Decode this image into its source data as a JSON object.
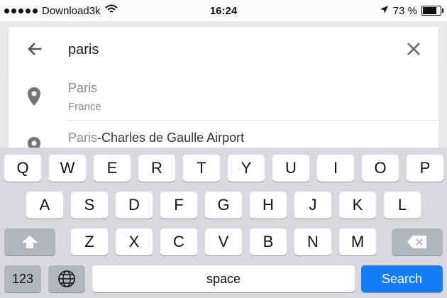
{
  "status_bar": {
    "carrier": "Download3k",
    "time": "16:24",
    "battery": "73 %"
  },
  "search": {
    "query": "paris",
    "back_icon": "arrow-left-icon",
    "clear_icon": "close-icon"
  },
  "suggestions": [
    {
      "match": "Paris",
      "rest": "",
      "subtitle": "France"
    },
    {
      "match": "Paris",
      "rest": "-Charles de Gaulle Airport",
      "subtitle": ""
    }
  ],
  "keyboard": {
    "row1": [
      "Q",
      "W",
      "E",
      "R",
      "T",
      "Y",
      "U",
      "I",
      "O",
      "P"
    ],
    "row2": [
      "A",
      "S",
      "D",
      "F",
      "G",
      "H",
      "J",
      "K",
      "L"
    ],
    "row3": [
      "Z",
      "X",
      "C",
      "V",
      "B",
      "N",
      "M"
    ],
    "numbers_key": "123",
    "space_key": "space",
    "search_key": "Search",
    "accent_color": "#157efb"
  }
}
